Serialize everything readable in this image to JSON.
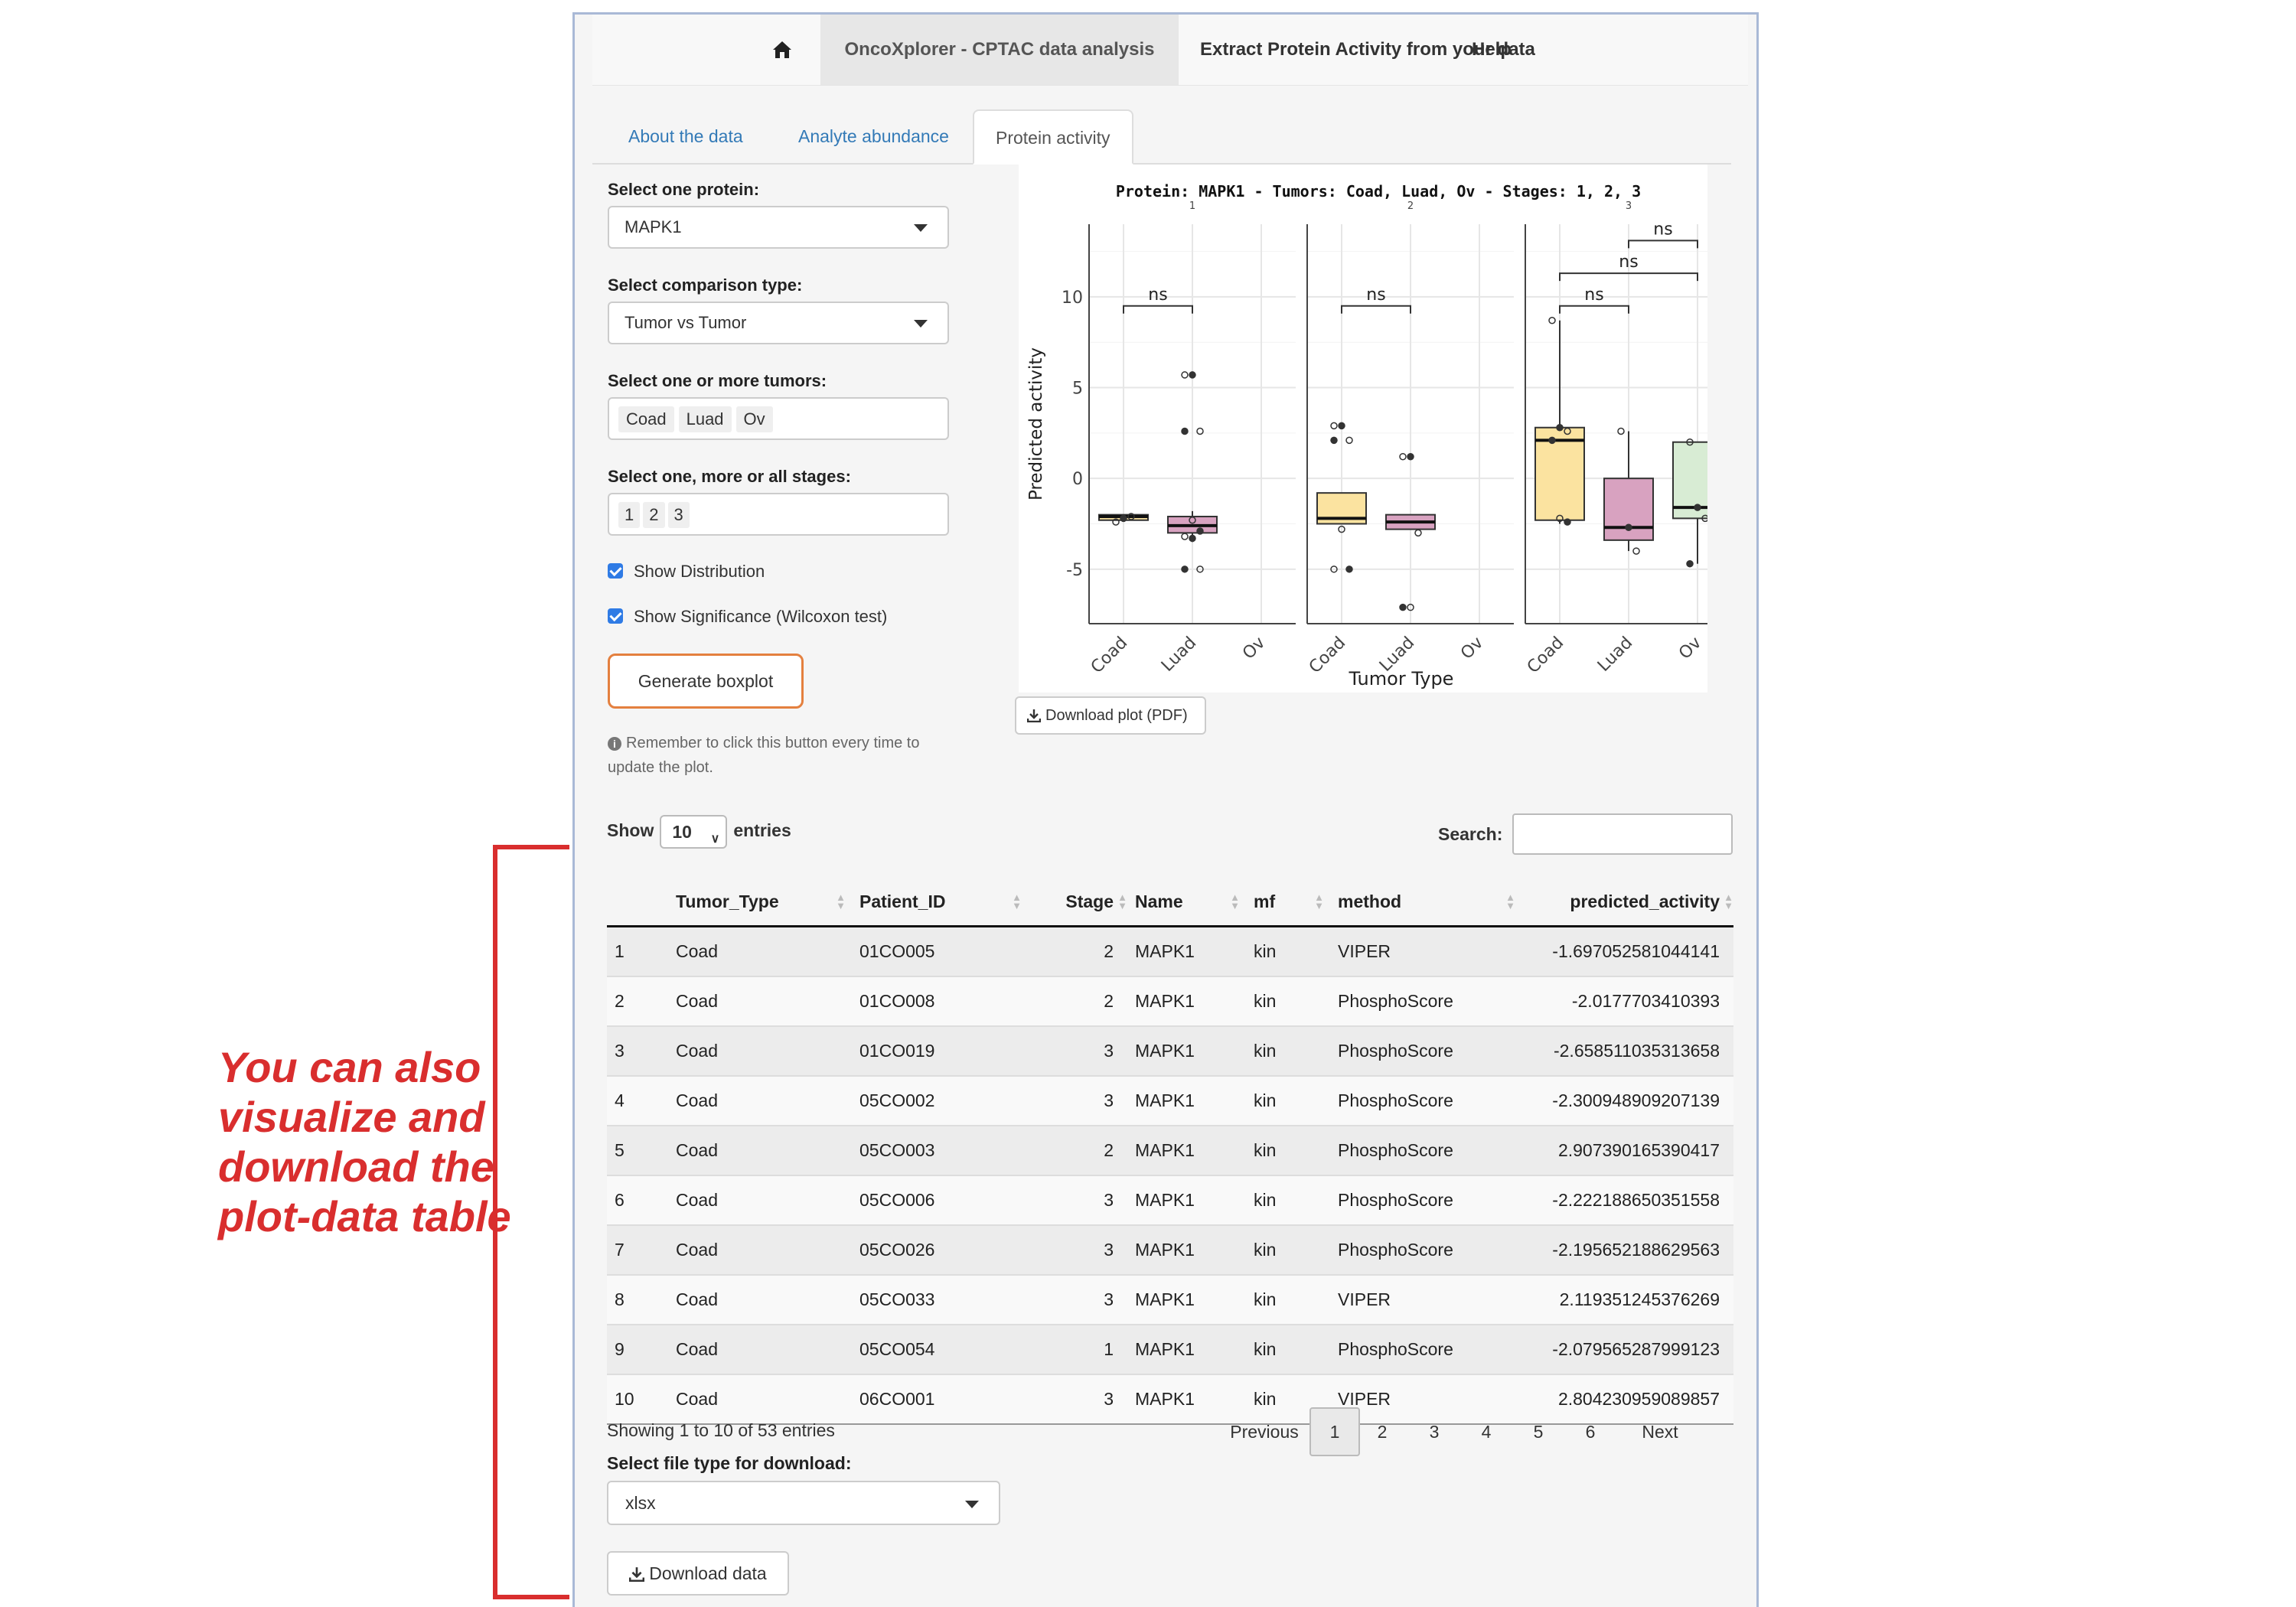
{
  "navbar": {
    "home_icon": "home-icon",
    "items": [
      {
        "label": "OncoXplorer - CPTAC data analysis",
        "active": true
      },
      {
        "label": "Extract Protein Activity from your data",
        "active": false
      },
      {
        "label": "Help",
        "active": false
      }
    ]
  },
  "tabs": [
    {
      "label": "About the data",
      "active": false
    },
    {
      "label": "Analyte abundance",
      "active": false
    },
    {
      "label": "Protein activity",
      "active": true
    }
  ],
  "controls": {
    "protein_label": "Select one protein:",
    "protein_value": "MAPK1",
    "comparison_label": "Select comparison type:",
    "comparison_value": "Tumor vs Tumor",
    "tumors_label": "Select one or more tumors:",
    "tumors": [
      "Coad",
      "Luad",
      "Ov"
    ],
    "stages_label": "Select one, more or all stages:",
    "stages": [
      "1",
      "2",
      "3"
    ],
    "show_distribution": {
      "label": "Show Distribution",
      "checked": true
    },
    "show_significance": {
      "label": "Show Significance (Wilcoxon test)",
      "checked": true
    },
    "generate_button": "Generate boxplot",
    "hint": "Remember to click this button every time to update the plot.",
    "download_plot": "Download plot (PDF)"
  },
  "chart_data": {
    "type": "boxplot",
    "title": "Protein: MAPK1 - Tumors: Coad, Luad, Ov - Stages: 1, 2, 3",
    "xlabel": "Tumor Type",
    "ylabel": "Predicted activity",
    "ylim": [
      -8,
      14
    ],
    "yticks": [
      -5,
      0,
      5,
      10
    ],
    "facets": [
      {
        "label": "1",
        "boxes": [
          {
            "group": "Coad",
            "min": -2.3,
            "q1": -2.3,
            "median": -2.1,
            "q3": -2.0,
            "max": -2.0,
            "points": [
              -2.4,
              -2.2,
              -2.1
            ]
          },
          {
            "group": "Luad",
            "min": -3.5,
            "q1": -3.0,
            "median": -2.6,
            "q3": -2.1,
            "max": -1.8,
            "points": [
              5.7,
              5.7,
              2.6,
              2.6,
              -2.3,
              -2.9,
              -3.2,
              -3.3,
              -5.0,
              -5.0
            ]
          },
          {
            "group": "Ov",
            "min": null,
            "q1": null,
            "median": null,
            "q3": null,
            "max": null,
            "points": []
          }
        ],
        "significance": [
          {
            "from": "Coad",
            "to": "Luad",
            "label": "ns",
            "y": 9.5
          }
        ]
      },
      {
        "label": "2",
        "boxes": [
          {
            "group": "Coad",
            "min": -2.5,
            "q1": -2.5,
            "median": -2.2,
            "q3": -0.8,
            "max": -0.8,
            "points": [
              2.9,
              2.9,
              2.1,
              2.1,
              -2.8,
              -5.0,
              -5.0
            ]
          },
          {
            "group": "Luad",
            "min": -2.8,
            "q1": -2.8,
            "median": -2.4,
            "q3": -2.0,
            "max": -2.0,
            "points": [
              1.2,
              1.2,
              -3.0,
              -7.1,
              -7.1
            ]
          },
          {
            "group": "Ov",
            "min": null,
            "q1": null,
            "median": null,
            "q3": null,
            "max": null,
            "points": []
          }
        ],
        "significance": [
          {
            "from": "Coad",
            "to": "Luad",
            "label": "ns",
            "y": 9.5
          }
        ]
      },
      {
        "label": "3",
        "boxes": [
          {
            "group": "Coad",
            "min": -2.5,
            "q1": -2.3,
            "median": 2.1,
            "q3": 2.8,
            "max": 8.7,
            "points": [
              8.7,
              2.8,
              2.6,
              2.1,
              -2.2,
              -2.4
            ]
          },
          {
            "group": "Luad",
            "min": -4.0,
            "q1": -3.4,
            "median": -2.7,
            "q3": 0.0,
            "max": 2.6,
            "points": [
              2.6,
              -2.7,
              -4.0
            ]
          },
          {
            "group": "Ov",
            "min": -4.7,
            "q1": -2.2,
            "median": -1.6,
            "q3": 2.0,
            "max": 2.0,
            "points": [
              2.0,
              -1.6,
              -2.2,
              -4.7
            ]
          }
        ],
        "significance": [
          {
            "from": "Coad",
            "to": "Luad",
            "label": "ns",
            "y": 9.5
          },
          {
            "from": "Coad",
            "to": "Ov",
            "label": "ns",
            "y": 11.3
          },
          {
            "from": "Luad",
            "to": "Ov",
            "label": "ns",
            "y": 13.1
          }
        ]
      }
    ],
    "colors": {
      "Coad": "#fbe3a0",
      "Luad": "#d8a2c0",
      "Ov": "#d8ecd4"
    }
  },
  "table": {
    "show_label": "Show",
    "entries_value": "10",
    "entries_label": "entries",
    "search_label": "Search:",
    "columns": [
      "",
      "Tumor_Type",
      "Patient_ID",
      "Stage",
      "Name",
      "mf",
      "method",
      "predicted_activity"
    ],
    "rows": [
      [
        "1",
        "Coad",
        "01CO005",
        "2",
        "MAPK1",
        "kin",
        "VIPER",
        "-1.697052581044141"
      ],
      [
        "2",
        "Coad",
        "01CO008",
        "2",
        "MAPK1",
        "kin",
        "PhosphoScore",
        "-2.0177703410393"
      ],
      [
        "3",
        "Coad",
        "01CO019",
        "3",
        "MAPK1",
        "kin",
        "PhosphoScore",
        "-2.658511035313658"
      ],
      [
        "4",
        "Coad",
        "05CO002",
        "3",
        "MAPK1",
        "kin",
        "PhosphoScore",
        "-2.300948909207139"
      ],
      [
        "5",
        "Coad",
        "05CO003",
        "2",
        "MAPK1",
        "kin",
        "PhosphoScore",
        "2.907390165390417"
      ],
      [
        "6",
        "Coad",
        "05CO006",
        "3",
        "MAPK1",
        "kin",
        "PhosphoScore",
        "-2.222188650351558"
      ],
      [
        "7",
        "Coad",
        "05CO026",
        "3",
        "MAPK1",
        "kin",
        "PhosphoScore",
        "-2.195652188629563"
      ],
      [
        "8",
        "Coad",
        "05CO033",
        "3",
        "MAPK1",
        "kin",
        "VIPER",
        "2.119351245376269"
      ],
      [
        "9",
        "Coad",
        "05CO054",
        "1",
        "MAPK1",
        "kin",
        "PhosphoScore",
        "-2.079565287999123"
      ],
      [
        "10",
        "Coad",
        "06CO001",
        "3",
        "MAPK1",
        "kin",
        "VIPER",
        "2.804230959089857"
      ]
    ],
    "info": "Showing 1 to 10 of 53 entries",
    "pagination": {
      "previous": "Previous",
      "pages": [
        "1",
        "2",
        "3",
        "4",
        "5",
        "6"
      ],
      "current": "1",
      "next": "Next"
    }
  },
  "download": {
    "file_type_label": "Select file type for download:",
    "file_type_value": "xlsx",
    "button": "Download data"
  },
  "annotation": {
    "text": "You can also visualize and download the plot-data table",
    "color": "#d92e2e"
  }
}
